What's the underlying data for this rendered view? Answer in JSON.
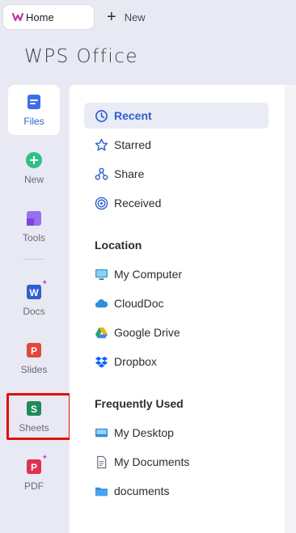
{
  "tabs": {
    "home_label": "Home",
    "new_label": "New"
  },
  "brand": {
    "name": "WPS Office"
  },
  "rail": {
    "files": "Files",
    "new": "New",
    "tools": "Tools",
    "docs": "Docs",
    "slides": "Slides",
    "sheets": "Sheets",
    "pdf": "PDF"
  },
  "nav": {
    "recent": "Recent",
    "starred": "Starred",
    "share": "Share",
    "received": "Received"
  },
  "location": {
    "title": "Location",
    "items": [
      "My Computer",
      "CloudDoc",
      "Google Drive",
      "Dropbox"
    ]
  },
  "frequent": {
    "title": "Frequently Used",
    "items": [
      "My Desktop",
      "My Documents",
      "documents"
    ]
  },
  "colors": {
    "accent": "#2f5fd0",
    "highlight": "#e01010",
    "docs": "#2f5fd0",
    "slides": "#e0493a",
    "sheets": "#1f8a5a",
    "pdf": "#e0304f",
    "new": "#2fc08a",
    "tools": "#8a5ae0"
  }
}
